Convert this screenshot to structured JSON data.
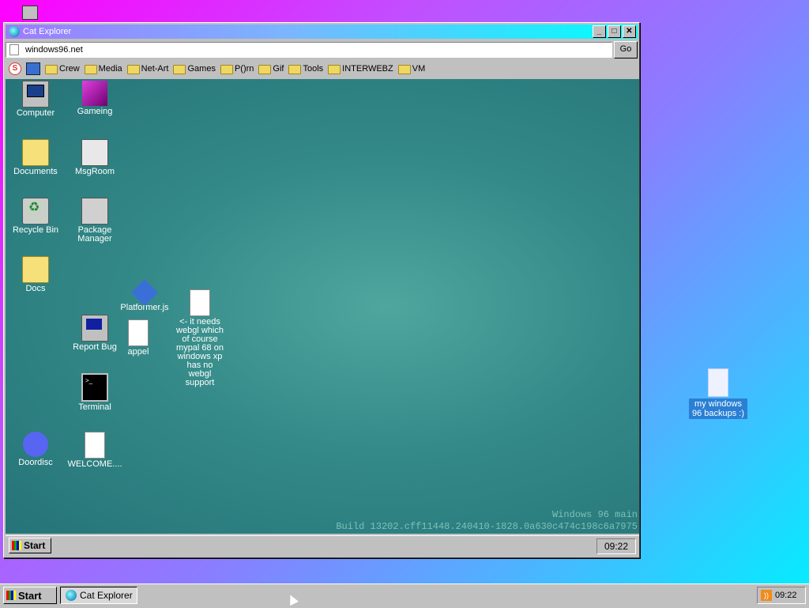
{
  "window": {
    "title": "Cat Explorer",
    "address": "windows96.net",
    "go_label": "Go",
    "bookmarks": [
      "Crew",
      "Media",
      "Net-Art",
      "Games",
      "P()rn",
      "Gif",
      "Tools",
      "INTERWEBZ",
      "VM"
    ],
    "controls": {
      "minimize": "_",
      "maximize": "□",
      "close": "✕"
    }
  },
  "inner_desktop": {
    "icons": {
      "computer": "Computer",
      "gameing": "Gameing",
      "documents": "Documents",
      "msgroom": "MsgRoom",
      "recycle_bin": "Recycle Bin",
      "package_manager": "Package Manager",
      "docs": "Docs",
      "platformer": "Platformer.js",
      "note": "<- it needs webgl which of course mypal 68 on windows xp has no webgl support",
      "report_bug": "Report Bug",
      "appel": "appel",
      "terminal": "Terminal",
      "doordisc": "Doordisc",
      "welcome": "WELCOME...."
    },
    "watermark_line1": "Windows 96 main",
    "watermark_line2": "Build 13202.cff11448.240410-1828.0a630c474c198c6a7975",
    "start_label": "Start",
    "clock": "09:22"
  },
  "outer_desktop": {
    "file_label": "my windows 96 backups :)"
  },
  "taskbar": {
    "start_label": "Start",
    "task_label": "Cat Explorer",
    "clock": "09:22"
  }
}
